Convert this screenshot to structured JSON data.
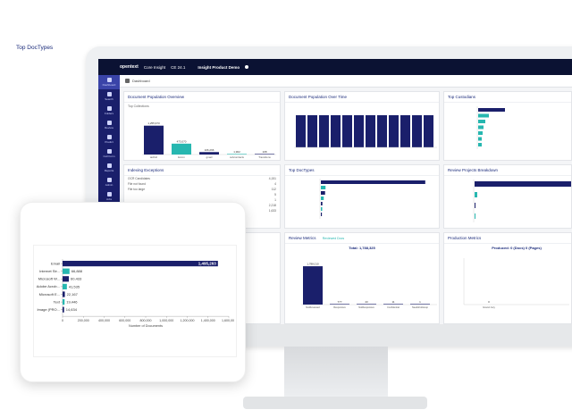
{
  "app": {
    "brand": "opentext",
    "product": "Core Insight",
    "version": "CE 24.1",
    "project": "Insight Product Demo"
  },
  "nav": [
    "Dashboard",
    "Search",
    "Folders",
    "Review",
    "Predict",
    "Cull Form",
    "Reports",
    "Admin",
    "Jobs"
  ],
  "breadcrumb": "Dashboard",
  "cards": {
    "overview": {
      "title": "Document Population Overview",
      "subtitle": "Top Collections",
      "bars": [
        {
          "label": "tactfuh",
          "value": "1,255,973"
        },
        {
          "label": "Enron",
          "value": "473,070"
        },
        {
          "label": "gmail",
          "value": "106,266"
        },
        {
          "label": "subcontracts",
          "value": "1,902"
        },
        {
          "label": "Transitions",
          "value": "108"
        }
      ]
    },
    "overtime": {
      "title": "Document Population Over Time"
    },
    "custodians": {
      "title": "Top Custodians"
    },
    "indexing": {
      "title": "Indexing Exceptions",
      "rows": [
        {
          "label": "OCR Candidates",
          "value": "4,151"
        },
        {
          "label": "File not found",
          "value": "4"
        },
        {
          "label": "File too large",
          "value": "112"
        },
        {
          "label": "",
          "value": "5"
        },
        {
          "label": "",
          "value": "1"
        },
        {
          "label": "",
          "value": "2,218"
        },
        {
          "label": "",
          "value": "1,633"
        }
      ]
    },
    "doctypes_small": {
      "title": "Top DocTypes"
    },
    "review_breakdown": {
      "title": "Review Projects Breakdown"
    },
    "review_metrics": {
      "title": "Review Metrics",
      "dropdown": "Reviewed Docs",
      "total": "Total: 1,788,325",
      "bars": [
        {
          "label": "NotReviewed",
          "value": "1,788,010"
        },
        {
          "label": "Responsive",
          "value": "777"
        },
        {
          "label": "NotResponsive",
          "value": "43"
        },
        {
          "label": "Confidential",
          "value": "11"
        },
        {
          "label": "NeedsFollowup",
          "value": "1"
        }
      ]
    },
    "production_metrics": {
      "title": "Production Metrics",
      "total": "Produced: 0 (Docs) 0 (Pages)",
      "bar_label": "Grand Jury",
      "bar_value": "0"
    }
  },
  "overlay": {
    "chart_data": {
      "type": "bar",
      "orientation": "horizontal",
      "title": "Top DocTypes",
      "xlabel": "Number of Documents",
      "categories": [
        "Email",
        "Internet Str...",
        "Microsoft W...",
        "Adobe Acrob...",
        "Microsoft E...",
        "Text",
        "Image (PRO..."
      ],
      "values": [
        1495263,
        66888,
        60433,
        41535,
        22167,
        19446,
        14634
      ],
      "labels": [
        "1,495,263",
        "66,888",
        "60,433",
        "41,535",
        "22,167",
        "19,446",
        "14,634"
      ],
      "xlim": [
        0,
        1600000
      ],
      "xticks": [
        "0",
        "200,000",
        "400,000",
        "600,000",
        "800,000",
        "1,000,000",
        "1,200,000",
        "1,400,000",
        "1,600,000"
      ],
      "colors": [
        "#1a1f6b",
        "#27b7b0",
        "#1a1f6b",
        "#27b7b0",
        "#1a1f6b",
        "#27b7b0",
        "#1a1f6b"
      ]
    }
  }
}
